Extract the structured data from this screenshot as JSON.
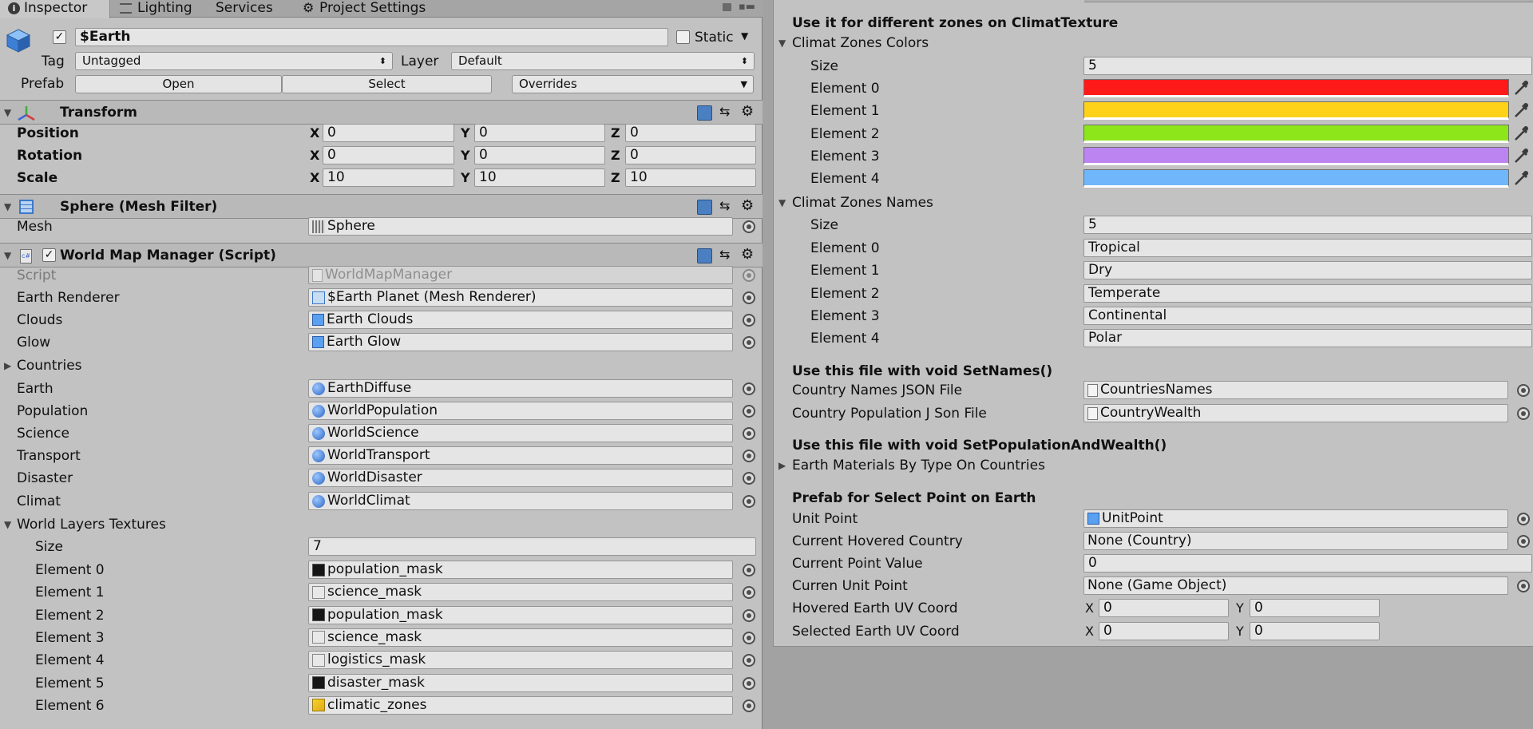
{
  "tabs": {
    "inspector": "Inspector",
    "lighting": "Lighting",
    "services": "Services",
    "project_settings": "Project Settings"
  },
  "gameobject": {
    "name": "$Earth",
    "static_label": "Static",
    "tag_label": "Tag",
    "tag_value": "Untagged",
    "layer_label": "Layer",
    "layer_value": "Default",
    "prefab_label": "Prefab",
    "open_label": "Open",
    "select_label": "Select",
    "overrides_label": "Overrides"
  },
  "transform": {
    "title": "Transform",
    "rows": [
      {
        "label": "Position",
        "x": "0",
        "y": "0",
        "z": "0"
      },
      {
        "label": "Rotation",
        "x": "0",
        "y": "0",
        "z": "0"
      },
      {
        "label": "Scale",
        "x": "10",
        "y": "10",
        "z": "10"
      }
    ]
  },
  "axis": {
    "x": "X",
    "y": "Y",
    "z": "Z"
  },
  "mesh_filter": {
    "title": "Sphere (Mesh Filter)",
    "mesh_label": "Mesh",
    "mesh_value": "Sphere"
  },
  "wmm": {
    "title": "World Map Manager (Script)",
    "script_label": "Script",
    "script_value": "WorldMapManager",
    "earth_renderer_label": "Earth Renderer",
    "earth_renderer_value": "$Earth Planet (Mesh Renderer)",
    "clouds_label": "Clouds",
    "clouds_value": "Earth Clouds",
    "glow_label": "Glow",
    "glow_value": "Earth Glow",
    "countries_label": "Countries",
    "earth_label": "Earth",
    "earth_value": "EarthDiffuse",
    "population_label": "Population",
    "population_value": "WorldPopulation",
    "science_label": "Science",
    "science_value": "WorldScience",
    "transport_label": "Transport",
    "transport_value": "WorldTransport",
    "disaster_label": "Disaster",
    "disaster_value": "WorldDisaster",
    "climat_label": "Climat",
    "climat_value": "WorldClimat",
    "layers_label": "World Layers Textures",
    "size_label": "Size",
    "size_value": "7",
    "elements": [
      {
        "label": "Element 0",
        "value": "population_mask",
        "tex": "dark"
      },
      {
        "label": "Element 1",
        "value": "science_mask",
        "tex": "light"
      },
      {
        "label": "Element 2",
        "value": "population_mask",
        "tex": "dark"
      },
      {
        "label": "Element 3",
        "value": "science_mask",
        "tex": "light"
      },
      {
        "label": "Element 4",
        "value": "logistics_mask",
        "tex": "light"
      },
      {
        "label": "Element 5",
        "value": "disaster_mask",
        "tex": "dark"
      },
      {
        "label": "Element 6",
        "value": "climatic_zones",
        "tex": "yellow"
      }
    ]
  },
  "right": {
    "header1": "Use it for different zones on ClimatTexture",
    "colors_label": "Climat Zones Colors",
    "size_label": "Size",
    "colors_size": "5",
    "colors": [
      {
        "label": "Element 0",
        "color": "#ff1a1a"
      },
      {
        "label": "Element 1",
        "color": "#ffd21a"
      },
      {
        "label": "Element 2",
        "color": "#8ce61a"
      },
      {
        "label": "Element 3",
        "color": "#bb84f0"
      },
      {
        "label": "Element 4",
        "color": "#70b6fa"
      }
    ],
    "names_label": "Climat Zones Names",
    "names_size": "5",
    "names": [
      {
        "label": "Element 0",
        "value": "Tropical"
      },
      {
        "label": "Element 1",
        "value": "Dry"
      },
      {
        "label": "Element 2",
        "value": "Temperate"
      },
      {
        "label": "Element 3",
        "value": "Continental"
      },
      {
        "label": "Element 4",
        "value": "Polar"
      }
    ],
    "header2": "Use this file with void SetNames()",
    "country_names_label": "Country Names JSON File",
    "country_names_value": "CountriesNames",
    "country_pop_label": "Country Population J Son File",
    "country_pop_value": "CountryWealth",
    "header3": "Use this file with void SetPopulationAndWealth()",
    "earth_materials_label": "Earth Materials By Type On Countries",
    "header4": "Prefab for Select Point on Earth",
    "unit_point_label": "Unit Point",
    "unit_point_value": "UnitPoint",
    "hovered_country_label": "Current Hovered Country",
    "hovered_country_value": "None (Country)",
    "point_value_label": "Current Point Value",
    "point_value_value": "0",
    "curren_unit_label": "Curren Unit Point",
    "curren_unit_value": "None (Game Object)",
    "hovered_uv_label": "Hovered Earth UV Coord",
    "hovered_uv_x": "0",
    "hovered_uv_y": "0",
    "selected_uv_label": "Selected Earth UV Coord",
    "selected_uv_x": "0",
    "selected_uv_y": "0"
  },
  "colors": {
    "panel_bg": "#c2c2c2",
    "tab_bg": "#a5a5a5",
    "field_bg": "#e5e5e5",
    "component_header": "#b9b9b9"
  }
}
